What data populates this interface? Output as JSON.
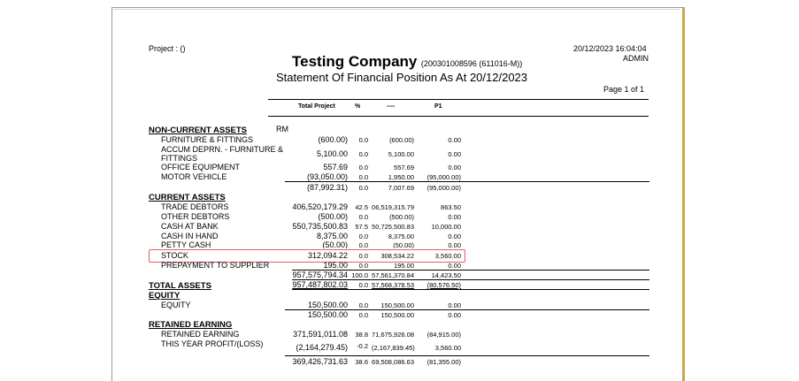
{
  "report": {
    "project_label": "Project : ()",
    "company": "Testing Company",
    "company_reg": "(200301008596 (611016-M))",
    "statement_title": "Statement Of Financial Position As At 20/12/2023",
    "datetime": "20/12/2023 16:04:04",
    "user": "ADMIN",
    "page": "Page 1 of 1",
    "currency": "RM"
  },
  "columns": {
    "total_project": "Total Project",
    "percent": "%",
    "dash": "----",
    "p1": "P1"
  },
  "sections": {
    "non_current_assets": "NON-CURRENT ASSETS",
    "current_assets": "CURRENT ASSETS",
    "total_assets": "TOTAL ASSETS",
    "equity": "EQUITY",
    "retained_earning": "RETAINED EARNING"
  },
  "rows": {
    "furniture": {
      "label": "FURNITURE & FITTINGS",
      "total": "(600.00)",
      "pct": "0.0",
      "dash": "(600.00)",
      "p1": "0.00"
    },
    "accum": {
      "label": "ACCUM DEPRN. - FURNITURE &",
      "label2": "FITTINGS",
      "total": "5,100.00",
      "pct": "0.0",
      "dash": "5,100.00",
      "p1": "0.00"
    },
    "office": {
      "label": "OFFICE EQUIPMENT",
      "total": "557.69",
      "pct": "0.0",
      "dash": "557.69",
      "p1": "0.00"
    },
    "motor": {
      "label": "MOTOR VEHICLE",
      "total": "(93,050.00)",
      "pct": "0.0",
      "dash": "1,950.00",
      "p1": "(95,000.00)"
    },
    "nca_total": {
      "total": "(87,992.31)",
      "pct": "0.0",
      "dash": "7,007.69",
      "p1": "(95,000.00)"
    },
    "trade": {
      "label": "TRADE DEBTORS",
      "total": "406,520,179.29",
      "pct": "42.5",
      "dash": "06,519,315.79",
      "p1": "863.50"
    },
    "other": {
      "label": "OTHER DEBTORS",
      "total": "(500.00)",
      "pct": "0.0",
      "dash": "(500.00)",
      "p1": "0.00"
    },
    "bank": {
      "label": "CASH AT BANK",
      "total": "550,735,500.83",
      "pct": "57.5",
      "dash": "50,725,500.83",
      "p1": "10,000.00"
    },
    "hand": {
      "label": "CASH IN HAND",
      "total": "8,375.00",
      "pct": "0.0",
      "dash": "8,375.00",
      "p1": "0.00"
    },
    "petty": {
      "label": "PETTY CASH",
      "total": "(50.00)",
      "pct": "0.0",
      "dash": "(50.00)",
      "p1": "0.00"
    },
    "stock": {
      "label": "STOCK",
      "total": "312,094.22",
      "pct": "0.0",
      "dash": "308,534.22",
      "p1": "3,560.00"
    },
    "prepay": {
      "label": "PREPAYMENT TO SUPPLIER",
      "total": "195.00",
      "pct": "0.0",
      "dash": "195.00",
      "p1": "0.00"
    },
    "ca_total": {
      "total": "957,575,794.34",
      "pct": "100.0",
      "dash": "57,561,370.84",
      "p1": "14,423.50"
    },
    "ta_total": {
      "total": "957,487,802.03",
      "pct": "0.0",
      "dash": "57,568,378.53",
      "p1": "(80,576.50)"
    },
    "equity": {
      "label": "EQUITY",
      "total": "150,500.00",
      "pct": "0.0",
      "dash": "150,500.00",
      "p1": "0.00"
    },
    "eq_total": {
      "total": "150,500.00",
      "pct": "0.0",
      "dash": "150,500.00",
      "p1": "0.00"
    },
    "re": {
      "label": "RETAINED EARNING",
      "total": "371,591,011.08",
      "pct": "38.8",
      "dash": "71,675,926.08",
      "p1": "(84,915.00)"
    },
    "typ": {
      "label": "THIS YEAR PROFIT/(LOSS)",
      "total": "(2,164,279.45)",
      "pct": "-0.2",
      "dash": "(2,167,839.45)",
      "p1": "3,560.00"
    },
    "re_total": {
      "total": "369,426,731.63",
      "pct": "38.6",
      "dash": "69,508,086.63",
      "p1": "(81,355.00)"
    }
  }
}
